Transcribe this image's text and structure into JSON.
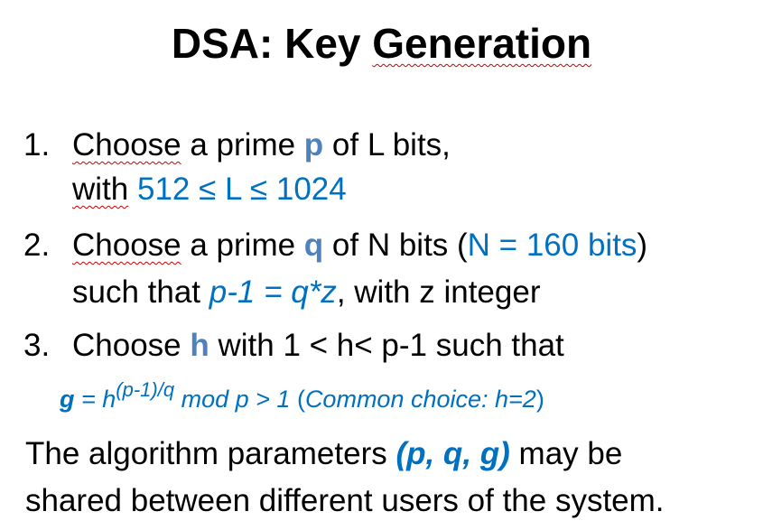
{
  "title": {
    "pre": "DSA: Key ",
    "underlined": "Generation"
  },
  "step1": {
    "number": "1.",
    "choose": "Choose",
    "t1": " a prime ",
    "p": "p",
    "t2": " of  L bits,",
    "with": "with",
    "range": " 512 ≤ L ≤ 1024"
  },
  "step2": {
    "number": "2.",
    "choose": "Choose",
    "t1": " a prime ",
    "q": "q",
    "t2": " of N bits (",
    "nbits": "N = 160 bits",
    "t3": ")",
    "t4": "such that ",
    "relation": "p-1 = q*z",
    "t5": ", with z integer"
  },
  "step3": {
    "number": "3.",
    "t1": "Choose ",
    "h": "h",
    "t2": " with 1 < h< p-1 such that",
    "g": "g",
    "eq": " = h",
    "exp": "(p-1)/q",
    "mod": " mod p  > 1",
    "paren_open": " (",
    "common": "Common choice: h=2",
    "paren_close": ")"
  },
  "closing": {
    "t1": "The algorithm parameters ",
    "params": "(p, q, g)",
    "t2": " may be",
    "line2": "shared between different users of the system."
  }
}
